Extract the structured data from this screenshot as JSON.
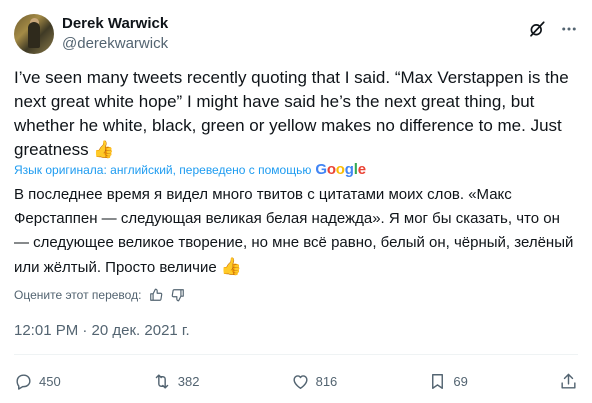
{
  "author": {
    "name": "Derek Warwick",
    "handle": "@derekwarwick"
  },
  "tweet": {
    "text": "I’ve seen many tweets recently quoting that I said. “Max Verstappen is the next great white hope” I might have said he’s the next great thing, but whether he white, black, green or yellow makes no difference to me. Just greatness",
    "emoji": "👍",
    "translation_note": "Язык оригинала: английский, переведено с помощью",
    "translation_provider": "Google",
    "translated_text": "В последнее время я видел много твитов с цитатами моих слов. «Макс Ферстаппен — следующая великая белая надежда». Я мог бы сказать, что он — следующее великое творение, но мне всё равно, белый он, чёрный, зелёный или жёлтый. Просто величие",
    "rate_translation_label": "Оцените этот перевод:",
    "timestamp": "12:01 PM · 20 дек. 2021 г."
  },
  "stats": {
    "replies": "450",
    "reposts": "382",
    "likes": "816",
    "bookmarks": "69"
  },
  "colors": {
    "text": "#0f1419",
    "secondary": "#536471",
    "link": "#1d9bf0"
  }
}
